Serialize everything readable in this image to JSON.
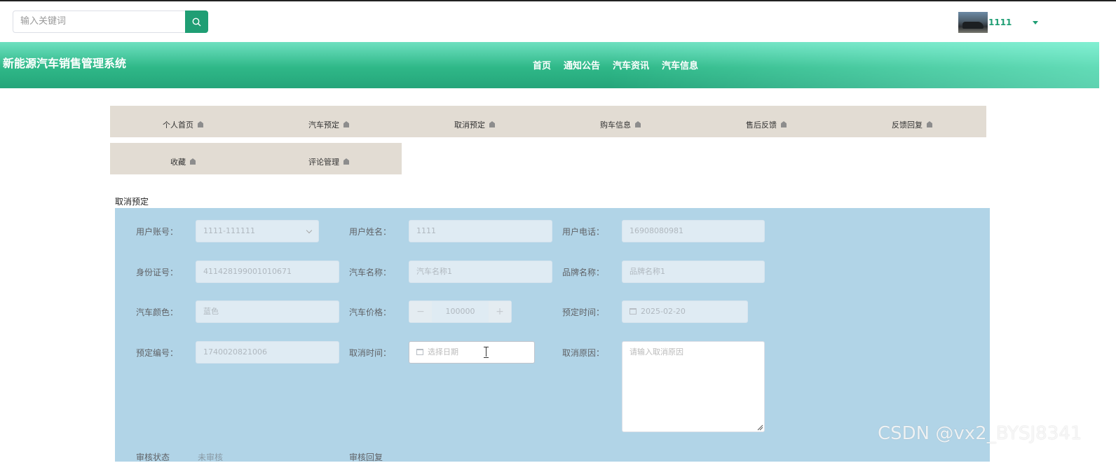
{
  "search": {
    "placeholder": "输入关键词"
  },
  "user": {
    "name": "1111"
  },
  "site": {
    "title": "新能源汽车销售管理系统"
  },
  "nav": [
    "首页",
    "通知公告",
    "汽车资讯",
    "汽车信息"
  ],
  "menu": {
    "row1": [
      "个人首页",
      "汽车预定",
      "取消预定",
      "购车信息",
      "售后反馈",
      "反馈回复"
    ],
    "row2": [
      "收藏",
      "评论管理"
    ]
  },
  "section_title": "取消预定",
  "form": {
    "account_label": "用户账号：",
    "account_value": "1111-111111",
    "name_label": "用户姓名：",
    "name_value": "1111",
    "phone_label": "用户电话：",
    "phone_value": "16908080981",
    "id_label": "身份证号：",
    "id_value": "411428199001010671",
    "car_label": "汽车名称：",
    "car_value": "汽车名称1",
    "brand_label": "品牌名称：",
    "brand_value": "品牌名称1",
    "color_label": "汽车颜色：",
    "color_value": "蓝色",
    "price_label": "汽车价格：",
    "price_value": "100000",
    "price_minus": "−",
    "price_plus": "+",
    "booktime_label": "预定时间：",
    "booktime_value": "2025-02-20",
    "bookno_label": "预定编号：",
    "bookno_value": "1740020821006",
    "canceltime_label": "取消时间：",
    "canceltime_placeholder": "选择日期",
    "reason_label": "取消原因：",
    "reason_placeholder": "请输入取消原因",
    "partial_left": "审核状态",
    "partial_left_value": "未审核",
    "partial_mid": "审核回复"
  },
  "watermark": "CSDN @vx2_BYSJ8341"
}
